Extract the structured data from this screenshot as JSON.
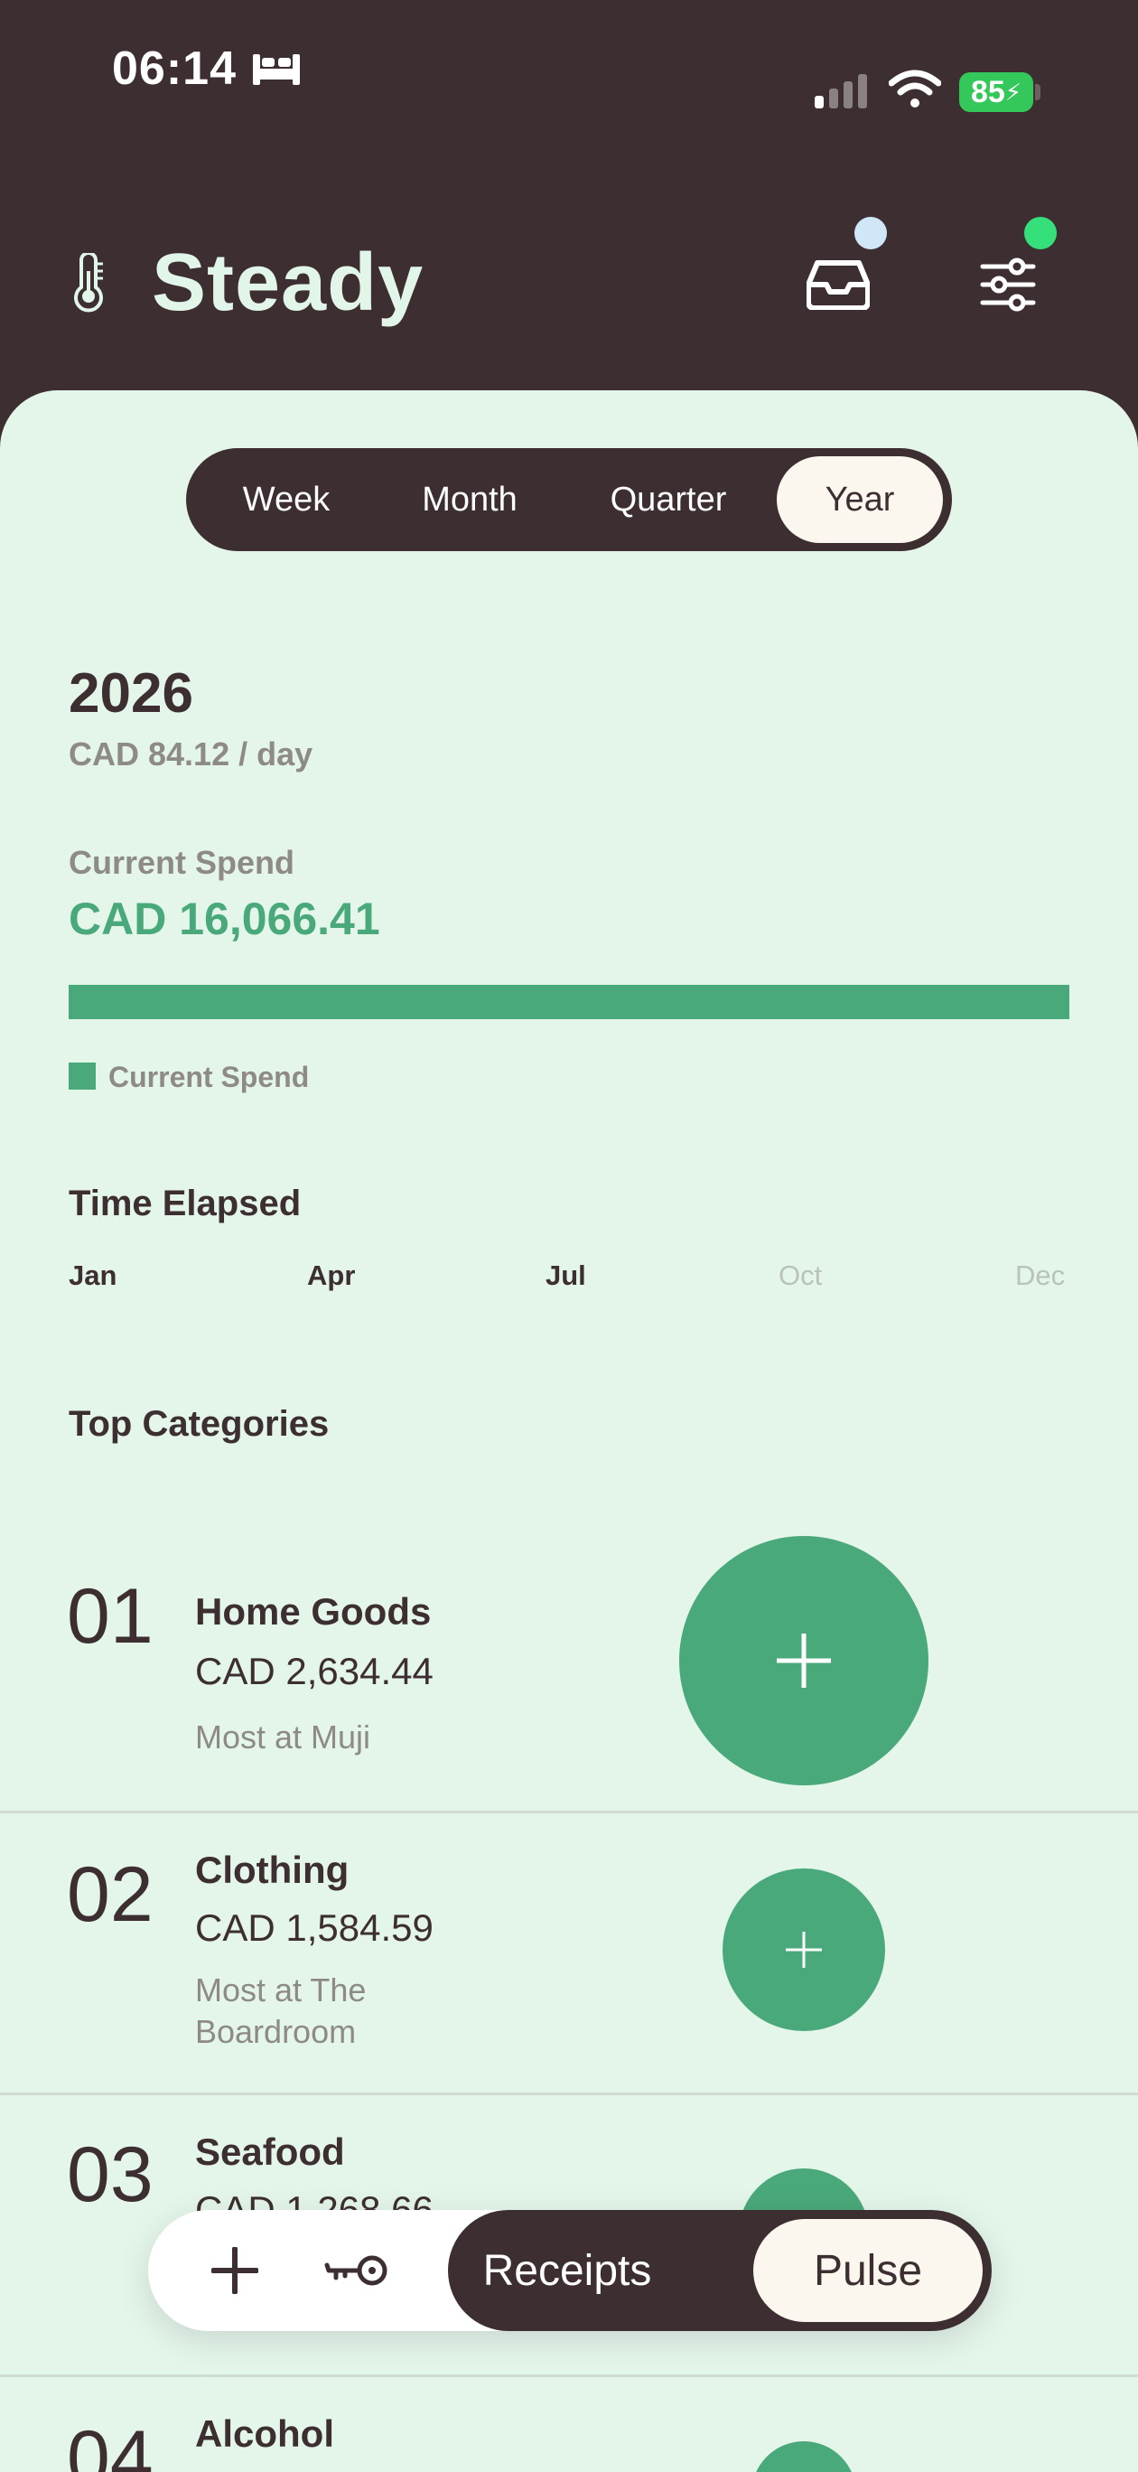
{
  "status_bar": {
    "time": "06:14",
    "battery": "85"
  },
  "header": {
    "title": "Steady"
  },
  "period_tabs": [
    {
      "label": "Week",
      "selected": false
    },
    {
      "label": "Month",
      "selected": false
    },
    {
      "label": "Quarter",
      "selected": false
    },
    {
      "label": "Year",
      "selected": true
    }
  ],
  "summary": {
    "year": "2026",
    "per_day": "CAD 84.12 / day",
    "spend_label": "Current Spend",
    "spend_value": "CAD 16,066.41",
    "spend_progress": 1.0,
    "legend_label": "Current Spend"
  },
  "time_elapsed": {
    "title": "Time Elapsed",
    "ticks": [
      {
        "label": "Jan",
        "elapsed": true
      },
      {
        "label": "Apr",
        "elapsed": true
      },
      {
        "label": "Jul",
        "elapsed": true
      },
      {
        "label": "Oct",
        "elapsed": false
      },
      {
        "label": "Dec",
        "elapsed": false
      }
    ]
  },
  "top_categories": {
    "title": "Top Categories",
    "items": [
      {
        "rank": "01",
        "name": "Home Goods",
        "amount": "CAD 2,634.44",
        "note": "Most at Muji"
      },
      {
        "rank": "02",
        "name": "Clothing",
        "amount": "CAD 1,584.59",
        "note": "Most at The Boardroom"
      },
      {
        "rank": "03",
        "name": "Seafood",
        "amount": "CAD 1,268.66",
        "note": ""
      },
      {
        "rank": "04",
        "name": "Alcohol",
        "amount": "",
        "note": ""
      }
    ]
  },
  "bottom_nav": {
    "receipts": "Receipts",
    "pulse": "Pulse"
  },
  "colors": {
    "accent": "#4aa97a",
    "dark": "#3d2f31",
    "sheet": "#e4f5ea",
    "cream": "#fbf6ee"
  }
}
